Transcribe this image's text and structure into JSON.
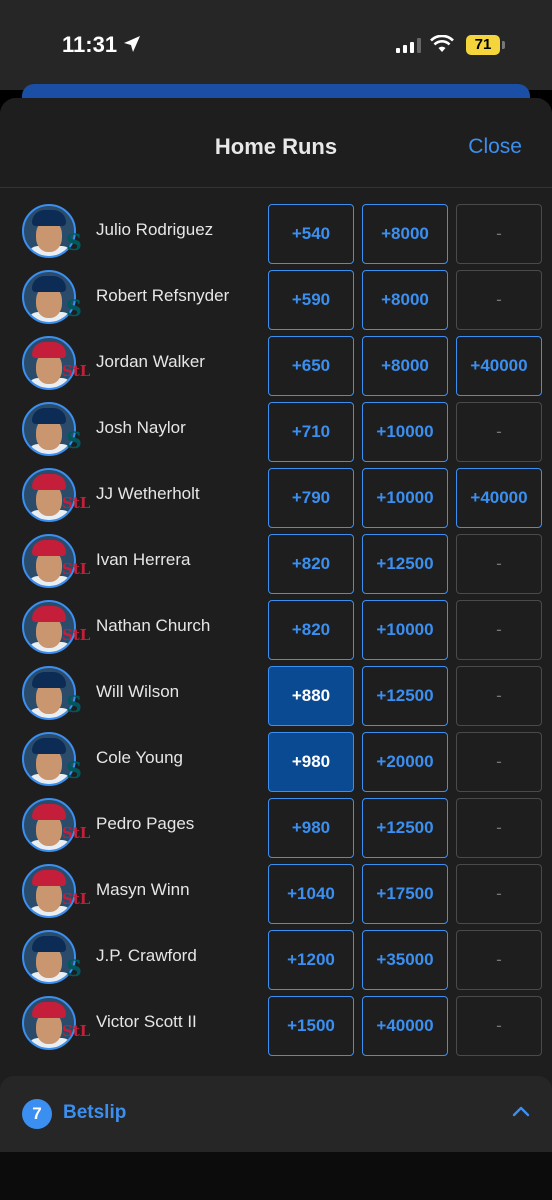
{
  "status_bar": {
    "time": "11:31",
    "battery": "71"
  },
  "header": {
    "title": "Home Runs",
    "close_label": "Close"
  },
  "colors": {
    "accent": "#3b8ff0",
    "selected": "#0a4a93",
    "mariners": "#00585f",
    "cardinals": "#c41e3a"
  },
  "rows": [
    {
      "name": "Julio Rodriguez",
      "team": "SEA",
      "odds": [
        "+540",
        "+8000",
        "-"
      ]
    },
    {
      "name": "Robert Refsnyder",
      "team": "SEA",
      "odds": [
        "+590",
        "+8000",
        "-"
      ]
    },
    {
      "name": "Jordan Walker",
      "team": "STL",
      "odds": [
        "+650",
        "+8000",
        "+40000"
      ]
    },
    {
      "name": "Josh Naylor",
      "team": "SEA",
      "odds": [
        "+710",
        "+10000",
        "-"
      ]
    },
    {
      "name": "JJ Wetherholt",
      "team": "STL",
      "odds": [
        "+790",
        "+10000",
        "+40000"
      ]
    },
    {
      "name": "Ivan Herrera",
      "team": "STL",
      "odds": [
        "+820",
        "+12500",
        "-"
      ]
    },
    {
      "name": "Nathan Church",
      "team": "STL",
      "odds": [
        "+820",
        "+10000",
        "-"
      ]
    },
    {
      "name": "Will Wilson",
      "team": "SEA",
      "odds": [
        "+880",
        "+12500",
        "-"
      ],
      "selected": 0
    },
    {
      "name": "Cole Young",
      "team": "SEA",
      "odds": [
        "+980",
        "+20000",
        "-"
      ],
      "selected": 0
    },
    {
      "name": "Pedro Pages",
      "team": "STL",
      "odds": [
        "+980",
        "+12500",
        "-"
      ]
    },
    {
      "name": "Masyn Winn",
      "team": "STL",
      "odds": [
        "+1040",
        "+17500",
        "-"
      ]
    },
    {
      "name": "J.P. Crawford",
      "team": "SEA",
      "odds": [
        "+1200",
        "+35000",
        "-"
      ]
    },
    {
      "name": "Victor Scott II",
      "team": "STL",
      "odds": [
        "+1500",
        "+40000",
        "-"
      ]
    }
  ],
  "betslip": {
    "count": "7",
    "label": "Betslip"
  }
}
